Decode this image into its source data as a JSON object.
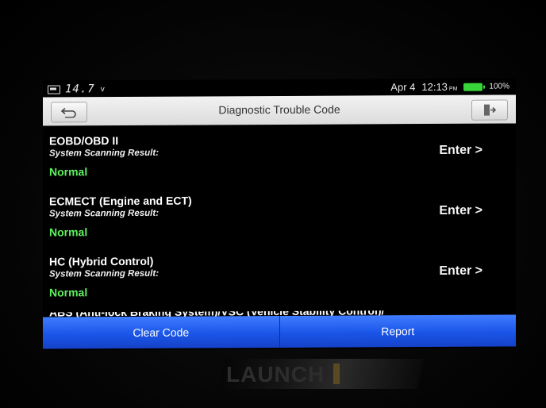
{
  "status_bar": {
    "voltage": "14.7",
    "voltage_unit": "v",
    "date": "Apr 4",
    "time": "12:13",
    "ampm": "PM",
    "battery_percent": "100%",
    "battery_color": "#39d43a"
  },
  "title_bar": {
    "title": "Diagnostic Trouble Code",
    "back_icon": "back-arrow-icon",
    "exit_icon": "exit-icon"
  },
  "items": [
    {
      "title": "EOBD/OBD II",
      "subtitle": "System Scanning Result:",
      "status": "Normal",
      "action": "Enter >"
    },
    {
      "title": "ECMECT (Engine and ECT)",
      "subtitle": "System Scanning Result:",
      "status": "Normal",
      "action": "Enter >"
    },
    {
      "title": "HC (Hybrid Control)",
      "subtitle": "System Scanning Result:",
      "status": "Normal",
      "action": "Enter >"
    }
  ],
  "partial_item": {
    "title": "ABS (Anti-lock Braking System)/VSC (Vehicle Stability Control)/"
  },
  "bottom_bar": {
    "clear_code": "Clear Code",
    "report": "Report",
    "accent_color": "#1a55e8"
  },
  "device": {
    "brand": "LAUNCH"
  },
  "colors": {
    "status_normal": "#5ef05e"
  }
}
